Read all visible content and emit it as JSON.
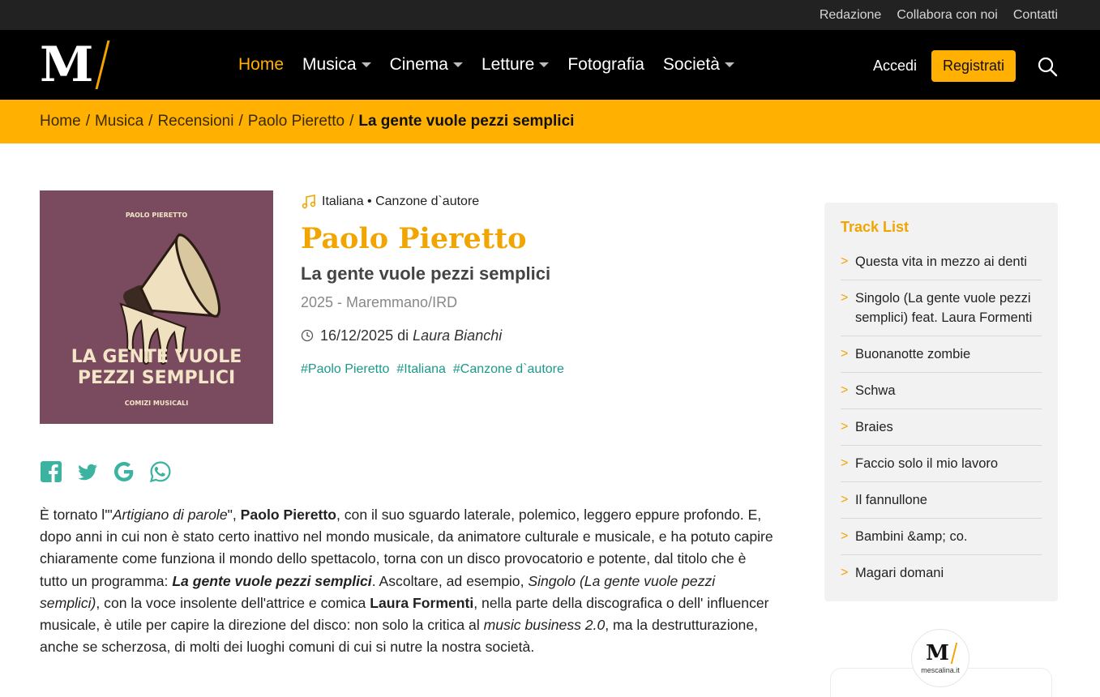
{
  "topbar": {
    "links": [
      "Redazione",
      "Collabora con noi",
      "Contatti"
    ]
  },
  "nav": {
    "logo_text": "M",
    "items": [
      {
        "label": "Home",
        "active": true,
        "dropdown": false
      },
      {
        "label": "Musica",
        "active": false,
        "dropdown": true
      },
      {
        "label": "Cinema",
        "active": false,
        "dropdown": true
      },
      {
        "label": "Letture",
        "active": false,
        "dropdown": true
      },
      {
        "label": "Fotografia",
        "active": false,
        "dropdown": false
      },
      {
        "label": "Società",
        "active": false,
        "dropdown": true
      }
    ],
    "login": "Accedi",
    "register": "Registrati",
    "search_icon": "search-icon"
  },
  "breadcrumb": {
    "items": [
      "Home",
      "Musica",
      "Recensioni",
      "Paolo Pieretto"
    ],
    "current": "La gente vuole pezzi semplici",
    "separator": "/"
  },
  "cover": {
    "artist": "PAOLO PIERETTO",
    "title_line1": "LA GENTE VUOLE",
    "title_line2": "PEZZI SEMPLICI",
    "label": "COMIZI MUSICALI"
  },
  "review": {
    "genre": "Italiana • Canzone d`autore",
    "artist": "Paolo Pieretto",
    "album": "La gente vuole pezzi semplici",
    "year_label": "2025 - Maremmano/IRD",
    "date": "16/12/2025",
    "by": "di",
    "author": "Laura Bianchi",
    "tags": [
      "#Paolo Pieretto",
      "#Italiana",
      "#Canzone d`autore"
    ]
  },
  "share": [
    "facebook-icon",
    "twitter-icon",
    "google-icon",
    "whatsapp-icon"
  ],
  "article": {
    "p1": "È tornato l'\"",
    "p1_i": "Artigiano di parole",
    "p2": "\", ",
    "p2_b": "Paolo Pieretto",
    "p3": ", con il suo sguardo laterale, polemico, leggero eppure profondo. E, dopo anni in cui non è stato certo inattivo nel mondo musicale, da animatore culturale e musicale, e ha potuto capire chiaramente come funziona il mondo dello spettacolo, torna con un disco provocatorio e potente, dal titolo che è tutto un programma: ",
    "p3_bi": "La gente vuole pezzi semplici",
    "p4": ". Ascoltare, ad esempio, ",
    "p4_i": "Singolo (La gente vuole pezzi semplici)",
    "p5": ", con la voce insolente dell'attrice e comica ",
    "p5_b": "Laura Formenti",
    "p6": ", nella parte della discografica o dell' influencer musicale, è utile per capire la direzione del disco: non solo la critica al ",
    "p6_i": "music business 2.0",
    "p7": ", ma la destrutturazione, anche se scherzosa, di molti dei luoghi comuni di cui si nutre la nostra società."
  },
  "tracklist": {
    "title": "Track List",
    "tracks": [
      "Questa vita in mezzo ai denti",
      "Singolo (La gente vuole pezzi semplici) feat. Laura Formenti",
      "Buonanotte zombie",
      "Schwa",
      "Braies",
      "Faccio solo il mio lavoro",
      "Il fannullone",
      "Bambini &amp; co.",
      "Magari domani"
    ]
  },
  "badge": {
    "logo": "M",
    "text": "mescalina.it"
  },
  "colors": {
    "accent": "#ffb000",
    "artist": "#f0a500",
    "tag": "#1a9a8a",
    "cover_bg": "#7a4a5e"
  }
}
